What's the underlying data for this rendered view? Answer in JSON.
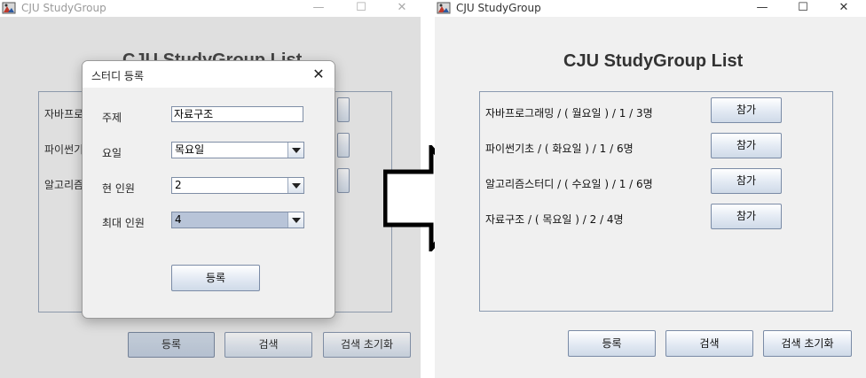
{
  "app": {
    "title": "CJU StudyGroup"
  },
  "window_controls": {
    "minimize": "—",
    "maximize": "☐",
    "close": "✕"
  },
  "main": {
    "heading": "CJU StudyGroup List",
    "buttons": {
      "register": "등록",
      "search": "검색",
      "reset": "검색 초기화"
    },
    "join_label": "참가"
  },
  "before": {
    "groups": [
      {
        "label": "자바프로"
      },
      {
        "label": "파이썬기"
      },
      {
        "label": "알고리즘"
      }
    ]
  },
  "dialog": {
    "title": "스터디 등록",
    "close": "✕",
    "fields": {
      "subject": {
        "label": "주제",
        "value": "자료구조"
      },
      "day": {
        "label": "요일",
        "value": "목요일"
      },
      "current": {
        "label": "현 인원",
        "value": "2"
      },
      "max": {
        "label": "최대 인원",
        "value": "4"
      }
    },
    "submit": "등록"
  },
  "after": {
    "groups": [
      {
        "label": "자바프로그래밍 / ( 월요일 ) / 1 / 3명"
      },
      {
        "label": "파이썬기초 / ( 화요일 ) / 1 / 6명"
      },
      {
        "label": "알고리즘스터디 / ( 수요일 ) / 1 / 6명"
      },
      {
        "label": "자료구조 / ( 목요일 ) / 2 / 4명"
      }
    ]
  },
  "colors": {
    "accent": "#7a8ba6",
    "panel_border": "#8a9ab0",
    "window_bg": "#f0f0f0"
  }
}
